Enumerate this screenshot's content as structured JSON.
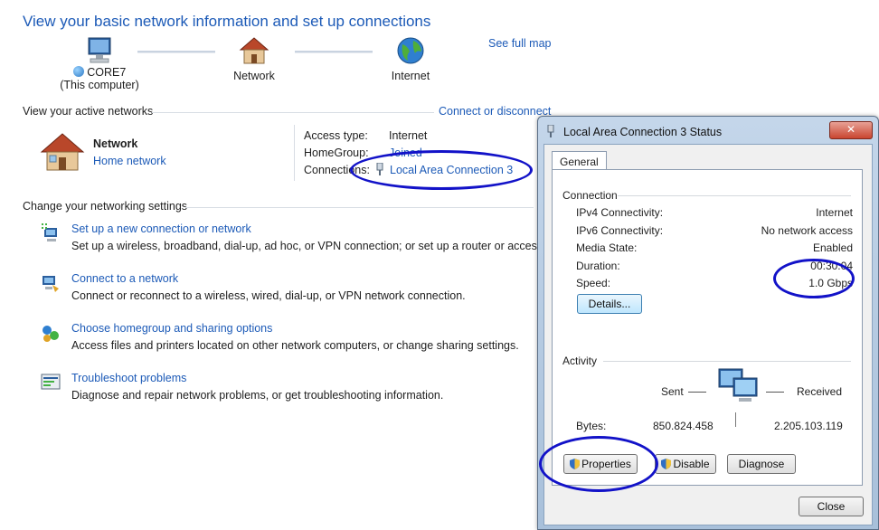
{
  "header": {
    "title": "View your basic network information and set up connections",
    "see_full_map": "See full map"
  },
  "network_map": {
    "computer_name": "CORE7",
    "computer_sub": "(This computer)",
    "network": "Network",
    "internet": "Internet"
  },
  "active_networks": {
    "heading": "View your active networks",
    "connect_link": "Connect or disconnect",
    "name": "Network",
    "type_link": "Home network",
    "access_type_label": "Access type:",
    "access_type_value": "Internet",
    "homegroup_label": "HomeGroup:",
    "homegroup_value": "Joined",
    "connections_label": "Connections:",
    "connections_value": "Local Area Connection 3"
  },
  "settings": {
    "heading": "Change your networking settings",
    "tasks": [
      {
        "title": "Set up a new connection or network",
        "desc": "Set up a wireless, broadband, dial-up, ad hoc, or VPN connection; or set up a router or access point."
      },
      {
        "title": "Connect to a network",
        "desc": "Connect or reconnect to a wireless, wired, dial-up, or VPN network connection."
      },
      {
        "title": "Choose homegroup and sharing options",
        "desc": "Access files and printers located on other network computers, or change sharing settings."
      },
      {
        "title": "Troubleshoot problems",
        "desc": "Diagnose and repair network problems, or get troubleshooting information."
      }
    ]
  },
  "dialog": {
    "title": "Local Area Connection 3 Status",
    "close_glyph": "✕",
    "tab_general": "General",
    "connection": {
      "heading": "Connection",
      "ipv4_label": "IPv4 Connectivity:",
      "ipv4_value": "Internet",
      "ipv6_label": "IPv6 Connectivity:",
      "ipv6_value": "No network access",
      "media_label": "Media State:",
      "media_value": "Enabled",
      "duration_label": "Duration:",
      "duration_value": "00:30:04",
      "speed_label": "Speed:",
      "speed_value": "1.0 Gbps",
      "details_button": "Details..."
    },
    "activity": {
      "heading": "Activity",
      "sent_label": "Sent",
      "received_label": "Received",
      "bytes_label": "Bytes:",
      "bytes_sent": "850.824.458",
      "bytes_received": "2.205.103.119"
    },
    "buttons": {
      "properties": "Properties",
      "disable": "Disable",
      "diagnose": "Diagnose",
      "close": "Close"
    }
  },
  "colors": {
    "link": "#1c5ab7",
    "annotation": "#1212c8"
  }
}
